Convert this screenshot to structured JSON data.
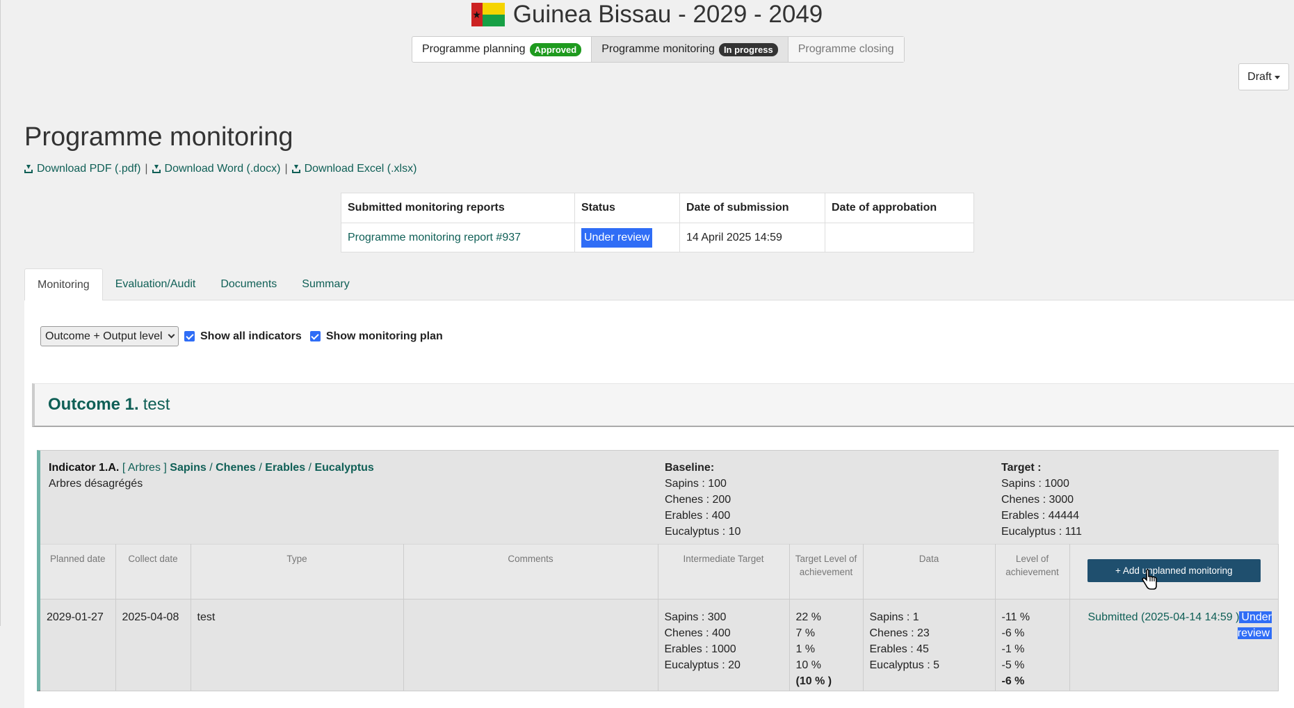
{
  "header": {
    "title": "Guinea Bissau - 2029 - 2049",
    "flag_icon": "guinea-bissau-flag-icon"
  },
  "phases": [
    {
      "label": "Programme planning",
      "badge": "Approved"
    },
    {
      "label": "Programme monitoring",
      "badge": "In progress"
    },
    {
      "label": "Programme closing"
    }
  ],
  "draft_dropdown": {
    "label": "Draft"
  },
  "page": {
    "title": "Programme monitoring"
  },
  "downloads": [
    {
      "label": "Download PDF (.pdf)"
    },
    {
      "label": "Download Word (.docx)"
    },
    {
      "label": "Download Excel (.xlsx)"
    }
  ],
  "reports_table": {
    "headers": [
      "Submitted monitoring reports",
      "Status",
      "Date of submission",
      "Date of approbation"
    ],
    "rows": [
      {
        "report": "Programme monitoring report #937",
        "status": "Under review",
        "submitted": "14 April 2025 14:59",
        "approved": ""
      }
    ]
  },
  "tabs": [
    "Monitoring",
    "Evaluation/Audit",
    "Documents",
    "Summary"
  ],
  "filters": {
    "level_select": "Outcome + Output level",
    "show_all_indicators": "Show all indicators",
    "show_monitoring_plan": "Show monitoring plan"
  },
  "outcome": {
    "label": "Outcome 1.",
    "name": "test"
  },
  "indicator": {
    "code": "Indicator 1.A.",
    "category": "[ Arbres ]",
    "dims": [
      "Sapins",
      "Chenes",
      "Erables",
      "Eucalyptus"
    ],
    "slash": "/",
    "description": "Arbres désagrégés",
    "baseline_label": "Baseline:",
    "baseline": [
      "Sapins : 100",
      "Chenes : 200",
      "Erables : 400",
      "Eucalyptus : 10"
    ],
    "target_label": "Target :",
    "target": [
      "Sapins : 1000",
      "Chenes : 3000",
      "Erables : 44444",
      "Eucalyptus : 111"
    ]
  },
  "monitoring_table": {
    "headers": {
      "planned": "Planned date",
      "collect": "Collect date",
      "type": "Type",
      "comments": "Comments",
      "intermediate": "Intermediate Target",
      "target_level": "Target Level of achievement",
      "data": "Data",
      "level": "Level of achievement"
    },
    "add_button": "+ Add unplanned monitoring",
    "row": {
      "planned": "2029-01-27",
      "collect": "2025-04-08",
      "type": "test",
      "comments": "",
      "intermediate": [
        "Sapins : 300",
        "Chenes : 400",
        "Erables : 1000",
        "Eucalyptus : 20"
      ],
      "target_level": [
        "22 %",
        "7 %",
        "1 %",
        "10 %"
      ],
      "target_level_total": "(10 % )",
      "data": [
        "Sapins : 1",
        "Chenes : 23",
        "Erables : 45",
        "Eucalyptus : 5"
      ],
      "level": [
        "-11 %",
        "-6 %",
        "-1 %",
        "-5 %"
      ],
      "level_total": "-6 %",
      "submitted": "Submitted (2025-04-14 14:59 )",
      "status": "Under review"
    }
  }
}
